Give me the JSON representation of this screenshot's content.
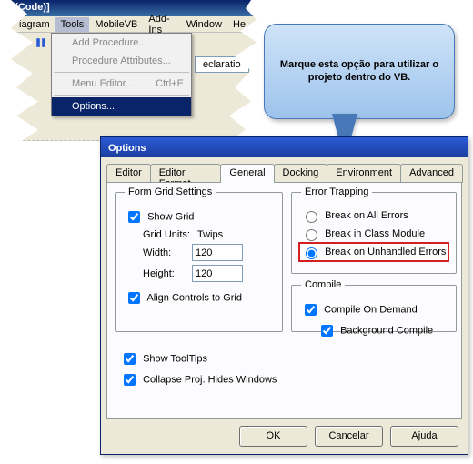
{
  "fragment": {
    "title": "s (Code)]",
    "menu": {
      "items": [
        "iagram",
        "Tools",
        "MobileVB",
        "Add-Ins",
        "Window",
        "He"
      ],
      "selected_index": 1
    },
    "dropdown": {
      "items": [
        {
          "label": "Add Procedure...",
          "enabled": false
        },
        {
          "label": "Procedure Attributes...",
          "enabled": false
        },
        {
          "label": "Menu Editor...",
          "accel": "Ctrl+E",
          "enabled": false
        },
        {
          "label": "Options...",
          "enabled": true,
          "selected": true
        }
      ]
    },
    "side_label": "eclaratio"
  },
  "callout": {
    "text": "Marque esta opção para utilizar o projeto dentro do VB."
  },
  "dialog": {
    "title": "Options",
    "tabs": [
      "Editor",
      "Editor Format",
      "General",
      "Docking",
      "Environment",
      "Advanced"
    ],
    "active_tab_index": 2,
    "form_grid": {
      "legend": "Form Grid Settings",
      "show_grid": {
        "label": "Show Grid",
        "checked": true
      },
      "grid_units_label": "Grid Units:",
      "grid_units_value": "Twips",
      "width_label": "Width:",
      "width_value": "120",
      "height_label": "Height:",
      "height_value": "120",
      "align": {
        "label": "Align Controls to Grid",
        "checked": true
      }
    },
    "error_trapping": {
      "legend": "Error Trapping",
      "options": [
        {
          "label": "Break on All Errors",
          "checked": false
        },
        {
          "label": "Break in Class Module",
          "checked": false
        },
        {
          "label": "Break on Unhandled Errors",
          "checked": true,
          "highlight": true
        }
      ]
    },
    "compile": {
      "legend": "Compile",
      "on_demand": {
        "label": "Compile On Demand",
        "checked": true
      },
      "background": {
        "label": "Background Compile",
        "checked": true
      }
    },
    "lower": {
      "tooltips": {
        "label": "Show ToolTips",
        "checked": true
      },
      "collapse": {
        "label": "Collapse Proj. Hides Windows",
        "checked": true
      }
    },
    "buttons": {
      "ok": "OK",
      "cancel": "Cancelar",
      "help": "Ajuda"
    }
  }
}
